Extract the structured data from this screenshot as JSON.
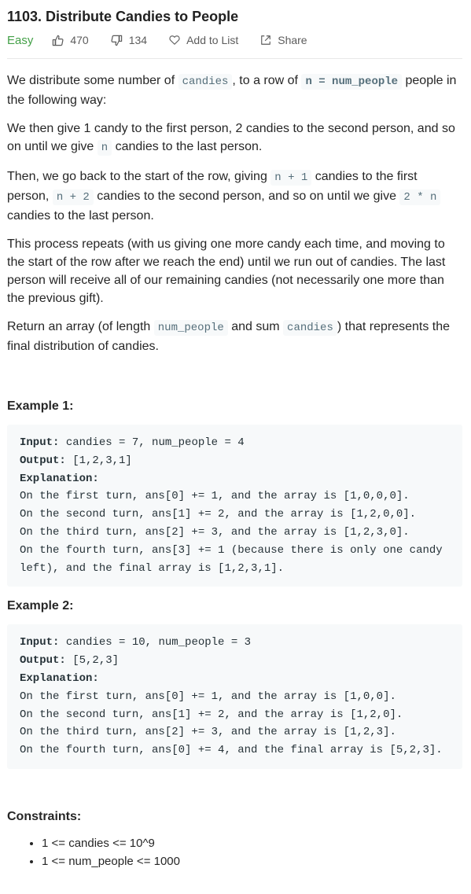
{
  "problem": {
    "title": "1103. Distribute Candies to People",
    "difficulty": "Easy",
    "likes": "470",
    "dislikes": "134",
    "add_to_list": "Add to List",
    "share": "Share"
  },
  "description": {
    "p1_a": "We distribute some number of ",
    "p1_code1": "candies",
    "p1_b": ", to a row of ",
    "p1_code2": "n = num_people",
    "p1_c": " people in the following way:",
    "p2_a": "We then give 1 candy to the first person, 2 candies to the second person, and so on until we give ",
    "p2_code1": "n",
    "p2_b": " candies to the last person.",
    "p3_a": "Then, we go back to the start of the row, giving ",
    "p3_code1": "n + 1",
    "p3_b": " candies to the first person, ",
    "p3_code2": "n + 2",
    "p3_c": " candies to the second person, and so on until we give ",
    "p3_code3": "2 * n",
    "p3_d": " candies to the last person.",
    "p4": "This process repeats (with us giving one more candy each time, and moving to the start of the row after we reach the end) until we run out of candies.  The last person will receive all of our remaining candies (not necessarily one more than the previous gift).",
    "p5_a": "Return an array (of length ",
    "p5_code1": "num_people",
    "p5_b": " and sum ",
    "p5_code2": "candies",
    "p5_c": ") that represents the final distribution of candies."
  },
  "examples": [
    {
      "title": "Example 1:",
      "input_label": "Input:",
      "input": " candies = 7, num_people = 4",
      "output_label": "Output:",
      "output": " [1,2,3,1]",
      "explanation_label": "Explanation:",
      "explanation": "On the first turn, ans[0] += 1, and the array is [1,0,0,0].\nOn the second turn, ans[1] += 2, and the array is [1,2,0,0].\nOn the third turn, ans[2] += 3, and the array is [1,2,3,0].\nOn the fourth turn, ans[3] += 1 (because there is only one candy left), and the final array is [1,2,3,1]."
    },
    {
      "title": "Example 2:",
      "input_label": "Input:",
      "input": " candies = 10, num_people = 3",
      "output_label": "Output:",
      "output": " [5,2,3]",
      "explanation_label": "Explanation:",
      "explanation": "On the first turn, ans[0] += 1, and the array is [1,0,0].\nOn the second turn, ans[1] += 2, and the array is [1,2,0].\nOn the third turn, ans[2] += 3, and the array is [1,2,3].\nOn the fourth turn, ans[0] += 4, and the final array is [5,2,3]."
    }
  ],
  "constraints": {
    "title": "Constraints:",
    "items": [
      "1 <= candies <= 10^9",
      "1 <= num_people <= 1000"
    ]
  },
  "colors": {
    "difficulty_easy": "#43a047",
    "code_background": "#f7f9fa",
    "inline_code_text": "#546e7a"
  },
  "icons": [
    "thumbs-up-icon",
    "thumbs-down-icon",
    "heart-icon",
    "share-icon"
  ]
}
